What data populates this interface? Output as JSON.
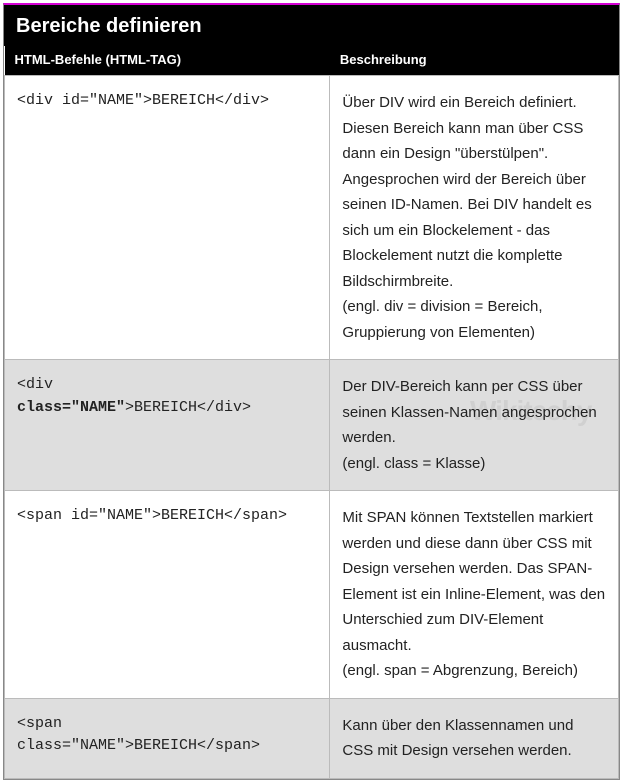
{
  "title": "Bereiche definieren",
  "columns": {
    "code": "HTML-Befehle (HTML-TAG)",
    "desc": "Beschreibung"
  },
  "rows": [
    {
      "code_segments": [
        {
          "text": "<div id=\"NAME\">BEREICH</div>",
          "bold": false
        }
      ],
      "desc": "Über DIV wird ein Bereich definiert. Diesen Bereich kann man über CSS dann ein Design \"überstülpen\". Angesprochen wird der Bereich über seinen ID-Namen. Bei DIV handelt es sich um ein Blockelement - das Blockelement nutzt die komplette Bildschirmbreite.\n(engl. div = division = Bereich, Gruppierung von Elementen)",
      "alt": false
    },
    {
      "code_segments": [
        {
          "text": "<div ",
          "bold": false,
          "br": true
        },
        {
          "text": "class=\"NAME\"",
          "bold": true
        },
        {
          "text": ">BEREICH</div>",
          "bold": false
        }
      ],
      "desc": "Der DIV-Bereich kann per CSS über seinen Klassen-Namen angesprochen werden.\n(engl. class = Klasse)",
      "alt": true
    },
    {
      "code_segments": [
        {
          "text": "<span id=\"NAME\">BEREICH</span>",
          "bold": false
        }
      ],
      "desc": "Mit SPAN können Textstellen markiert werden und diese dann über CSS mit Design versehen werden. Das SPAN-Element ist ein Inline-Element, was den Unterschied zum DIV-Element ausmacht.\n(engl. span = Abgrenzung, Bereich)",
      "alt": false
    },
    {
      "code_segments": [
        {
          "text": "<span ",
          "bold": false,
          "br": true
        },
        {
          "text": "class=\"NAME\">BEREICH</span>",
          "bold": false
        }
      ],
      "desc": "Kann über den Klassennamen und CSS mit Design versehen werden.",
      "alt": true
    }
  ],
  "watermark": "Wikitechy"
}
